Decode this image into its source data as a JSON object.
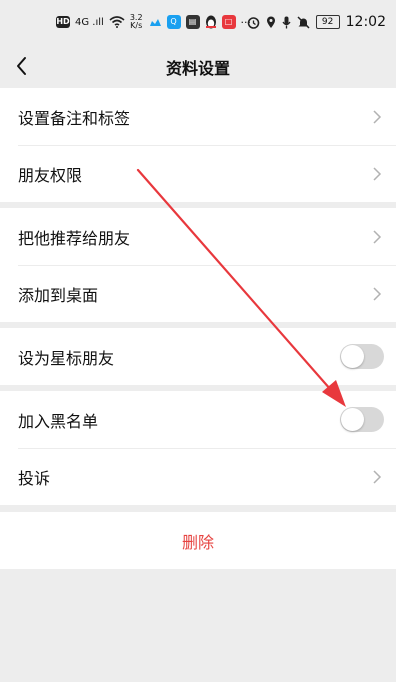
{
  "status_bar": {
    "hd_label": "HD",
    "signal_label": "4G .ıll",
    "wifi_icon": "wifi-icon",
    "speed_value": "3.2",
    "speed_unit": "K/s",
    "notification_icons": [
      "cloud-icon",
      "app-q-icon",
      "calendar-icon",
      "qq-penguin-icon",
      "app-red-icon"
    ],
    "more_label": "···",
    "right_icons": [
      "alarm-icon",
      "location-icon",
      "mic-icon",
      "mute-icon"
    ],
    "battery_level": "92",
    "time": "12:02"
  },
  "nav": {
    "back_icon": "chevron-left-icon",
    "title": "资料设置"
  },
  "groups": [
    {
      "rows": [
        {
          "label": "设置备注和标签",
          "control": "chevron"
        },
        {
          "label": "朋友权限",
          "control": "chevron"
        }
      ]
    },
    {
      "rows": [
        {
          "label": "把他推荐给朋友",
          "control": "chevron"
        },
        {
          "label": "添加到桌面",
          "control": "chevron"
        }
      ]
    },
    {
      "rows": [
        {
          "label": "设为星标朋友",
          "control": "toggle",
          "on": false
        }
      ]
    },
    {
      "rows": [
        {
          "label": "加入黑名单",
          "control": "toggle",
          "on": false
        },
        {
          "label": "投诉",
          "control": "chevron"
        }
      ]
    }
  ],
  "delete": {
    "label": "删除",
    "color": "#e64340"
  },
  "colors": {
    "background": "#ededed",
    "cell": "#ffffff",
    "toggle_off": "#d8d8d8",
    "annotation_arrow": "#e8383d"
  }
}
